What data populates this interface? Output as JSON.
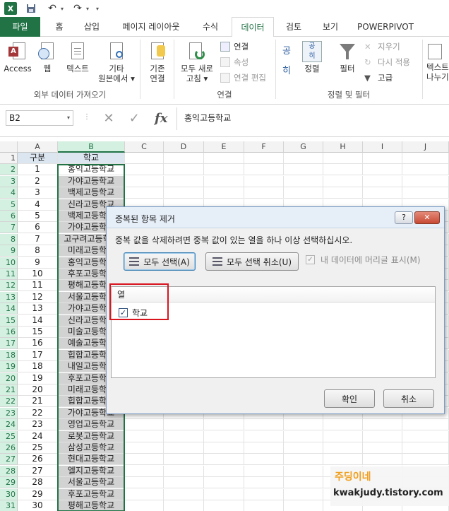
{
  "qat": {
    "app_icon": "X"
  },
  "tabs": [
    {
      "label": "파일"
    },
    {
      "label": "홈"
    },
    {
      "label": "삽입"
    },
    {
      "label": "페이지 레이아웃"
    },
    {
      "label": "수식"
    },
    {
      "label": "데이터"
    },
    {
      "label": "검토"
    },
    {
      "label": "보기"
    },
    {
      "label": "POWERPIVOT"
    }
  ],
  "ribbon": {
    "access": "Access",
    "web": "웹",
    "text": "텍스트",
    "other_line1": "기타",
    "other_line2": "원본에서 ▾",
    "existing_line1": "기존",
    "existing_line2": "연결",
    "refresh_line1": "모두 새로",
    "refresh_line2": "고침 ▾",
    "connections": "연결",
    "properties": "속성",
    "edit_links": "연결 편집",
    "sort_az": "공",
    "sort_za": "히",
    "sort": "정렬",
    "filter": "필터",
    "clear": "지우기",
    "reapply": "다시 적용",
    "advanced": "고급",
    "text_split_line1": "텍스트",
    "text_split_line2": "나누기",
    "group_external": "외부 데이터 가져오기",
    "group_connections": "연결",
    "group_sortfilter": "정렬 및 필터"
  },
  "formula_bar": {
    "name_box": "B2",
    "fx": "fx",
    "content": "홍익고등학교"
  },
  "grid": {
    "columns": [
      "A",
      "B",
      "C",
      "D",
      "E",
      "F",
      "G",
      "H",
      "I",
      "J"
    ],
    "header_row": [
      "구분",
      "학교"
    ],
    "rows": [
      [
        "1",
        "홍익고등학교"
      ],
      [
        "2",
        "가야고등학교"
      ],
      [
        "3",
        "백제고등학교"
      ],
      [
        "4",
        "신라고등학교"
      ],
      [
        "5",
        "백제고등학교"
      ],
      [
        "6",
        "가야고등학교"
      ],
      [
        "7",
        "고구려고등학교"
      ],
      [
        "8",
        "미래고등학교"
      ],
      [
        "9",
        "홍익고등학교"
      ],
      [
        "10",
        "후포고등학교"
      ],
      [
        "11",
        "평해고등학교"
      ],
      [
        "12",
        "서울고등학교"
      ],
      [
        "13",
        "가야고등학교"
      ],
      [
        "14",
        "신라고등학교"
      ],
      [
        "15",
        "미술고등학교"
      ],
      [
        "16",
        "예술고등학교"
      ],
      [
        "17",
        "힙합고등학교"
      ],
      [
        "18",
        "내일고등학교"
      ],
      [
        "19",
        "후포고등학교"
      ],
      [
        "20",
        "미래고등학교"
      ],
      [
        "21",
        "힙합고등학교"
      ],
      [
        "22",
        "가야고등학교"
      ],
      [
        "23",
        "영업고등학교"
      ],
      [
        "24",
        "로봇고등학교"
      ],
      [
        "25",
        "삼성고등학교"
      ],
      [
        "26",
        "현대고등학교"
      ],
      [
        "27",
        "엘지고등학교"
      ],
      [
        "28",
        "서울고등학교"
      ],
      [
        "29",
        "후포고등학교"
      ],
      [
        "30",
        "평해고등학교"
      ]
    ]
  },
  "dialog": {
    "title": "중복된 항목 제거",
    "help": "?",
    "close": "✕",
    "message": "중복 값을 삭제하려면 중복 값이 있는 열을 하나 이상 선택하십시오.",
    "select_all": "모두 선택(A)",
    "unselect_all": "모두 선택 취소(U)",
    "has_headers": "내 데이터에 머리글 표시(M)",
    "columns_header": "열",
    "column_item": "학교",
    "ok": "확인",
    "cancel": "취소"
  },
  "watermark": {
    "line1": "주딩이네",
    "line2": "kwakjudy.tistory.com"
  }
}
